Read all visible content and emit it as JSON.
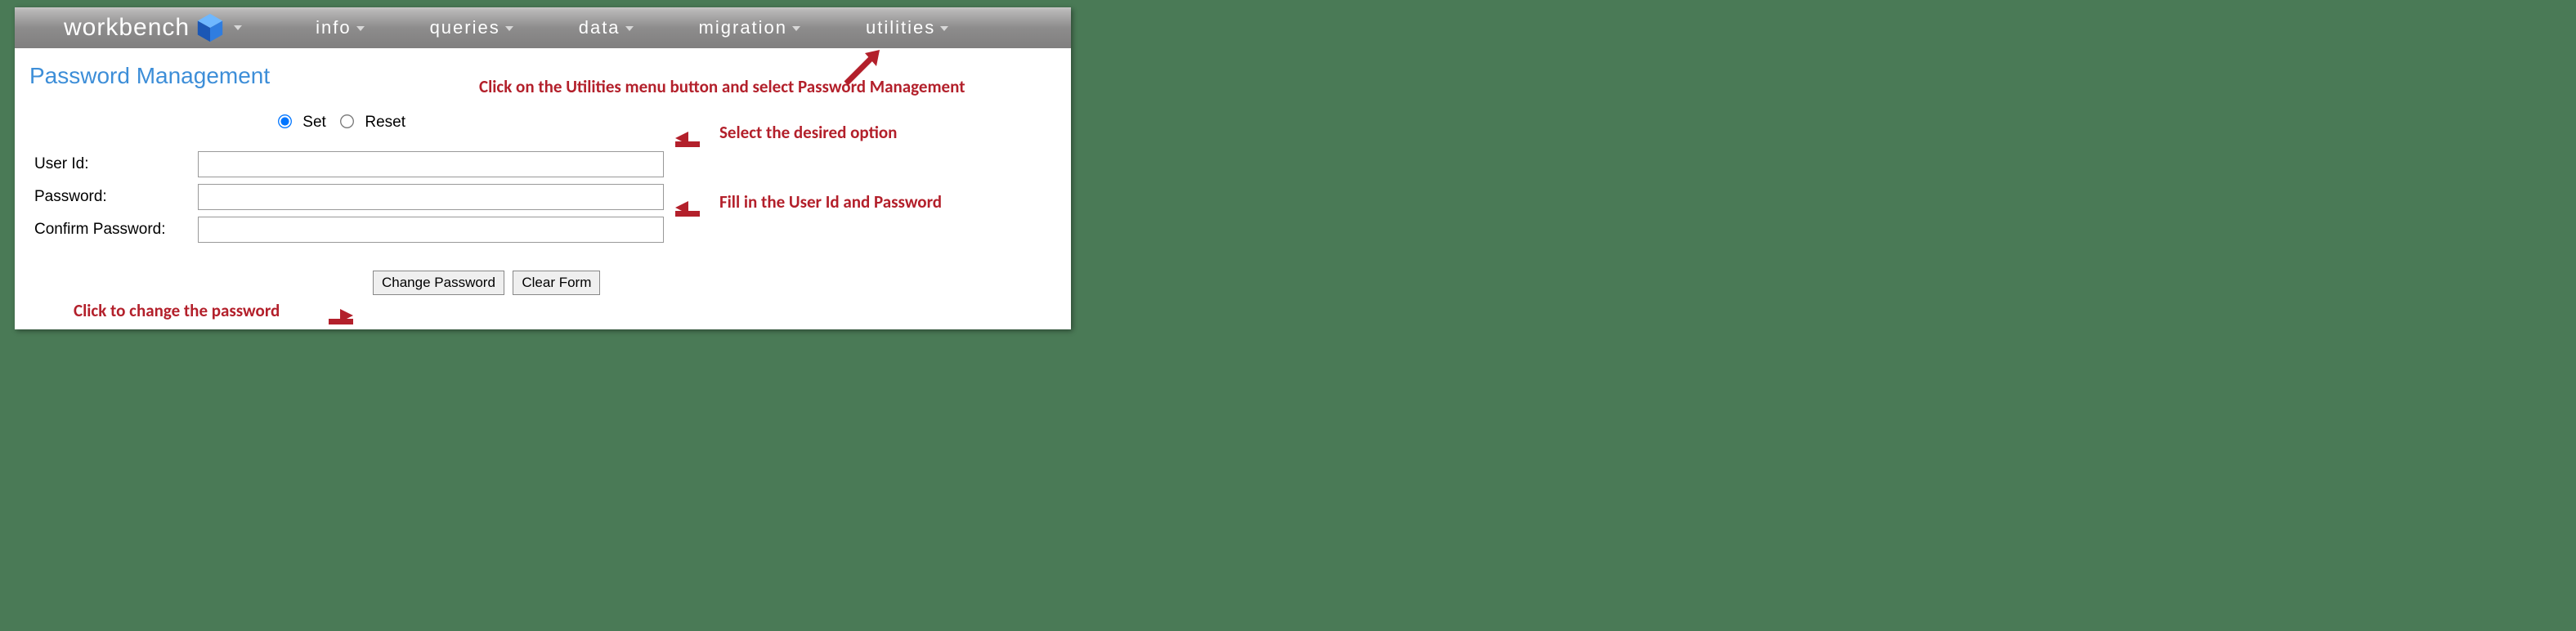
{
  "brand": "workbench",
  "nav": {
    "info": "info",
    "queries": "queries",
    "data": "data",
    "migration": "migration",
    "utilities": "utilities"
  },
  "page": {
    "title": "Password Management",
    "radio": {
      "set": "Set",
      "reset": "Reset"
    },
    "labels": {
      "userId": "User Id:",
      "password": "Password:",
      "confirm": "Confirm Password:"
    },
    "buttons": {
      "change": "Change Password",
      "clear": "Clear Form"
    }
  },
  "annotations": {
    "utilities": "Click on the Utilities menu button and select Password Management",
    "option": "Select the desired option",
    "fill": "Fill in the User Id and Password",
    "change": "Click to change the password"
  }
}
